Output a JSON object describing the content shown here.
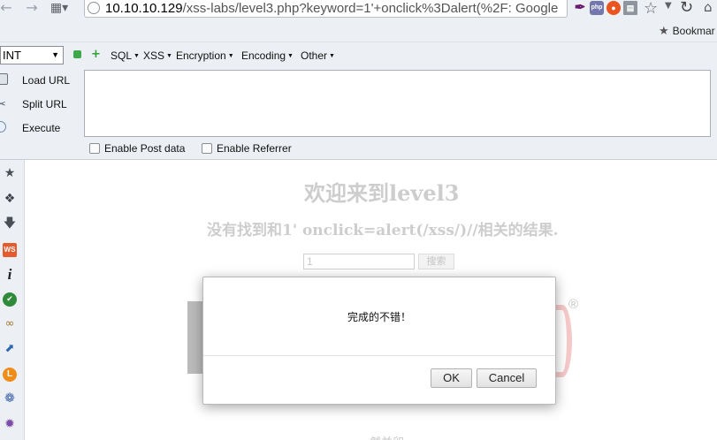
{
  "browser": {
    "url_host": "10.10.10.129",
    "url_rest": "/xss-labs/level3.php?keyword=1'+onclick%3Dalert(%2F: Google",
    "search_engine_glyph": "g",
    "ext_php_label": "php",
    "bookmarks_label": "Bookmar",
    "icons": {
      "back": "back-arrow-icon",
      "forward": "forward-arrow-icon",
      "apps": "apps-grid-icon",
      "star": "star-icon",
      "reload": "reload-icon",
      "home": "home-icon"
    }
  },
  "hackbar": {
    "type_select": "INT",
    "menus": [
      "SQL",
      "XSS",
      "Encryption",
      "Encoding",
      "Other"
    ],
    "actions": [
      "Load URL",
      "Split URL",
      "Execute"
    ],
    "url_value": "",
    "checkboxes": [
      "Enable Post data",
      "Enable Referrer"
    ]
  },
  "side_toolbar": {
    "ws_label": "WS",
    "info_label": "i",
    "l_label": "L"
  },
  "page": {
    "heading": "欢迎来到level3",
    "result_text": "没有找到和1' onclick=alert(/xss/)//相关的结果.",
    "keyword_value": "1",
    "search_button": "搜索",
    "registered_mark": "®",
    "footer_partial": "然并卵"
  },
  "dialog": {
    "message": "完成的不错！",
    "ok_label": "OK",
    "cancel_label": "Cancel"
  },
  "colors": {
    "chrome_bg": "#eceff4",
    "heading_gray": "#cdcdcd",
    "dialog_border": "#b9b9b9"
  }
}
